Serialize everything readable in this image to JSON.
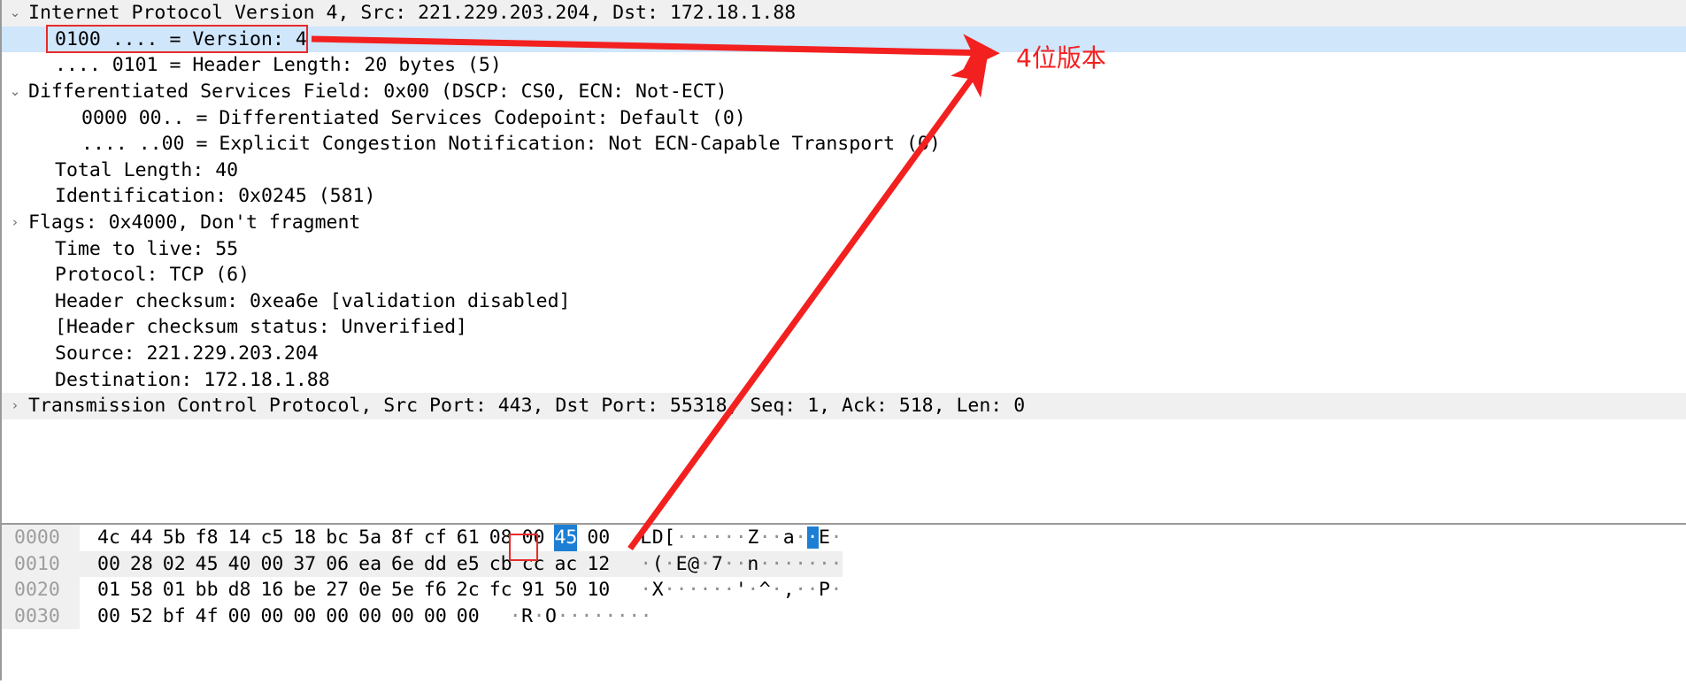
{
  "detail_tree": {
    "rows": [
      {
        "twisty": "expanded",
        "indent": 0,
        "text": "Internet Protocol Version 4, Src: 221.229.203.204, Dst: 172.18.1.88",
        "style": "proto"
      },
      {
        "twisty": "none",
        "indent": 1,
        "text": "0100 .... = Version: 4",
        "style": "selected"
      },
      {
        "twisty": "none",
        "indent": 1,
        "text": ".... 0101 = Header Length: 20 bytes (5)",
        "style": "normal"
      },
      {
        "twisty": "expanded",
        "indent": 0,
        "text": "Differentiated Services Field: 0x00 (DSCP: CS0, ECN: Not-ECT)",
        "style": "normal"
      },
      {
        "twisty": "none",
        "indent": 2,
        "text": "0000 00.. = Differentiated Services Codepoint: Default (0)",
        "style": "normal"
      },
      {
        "twisty": "none",
        "indent": 2,
        "text": ".... ..00 = Explicit Congestion Notification: Not ECN-Capable Transport (0)",
        "style": "normal"
      },
      {
        "twisty": "none",
        "indent": 1,
        "text": "Total Length: 40",
        "style": "normal"
      },
      {
        "twisty": "none",
        "indent": 1,
        "text": "Identification: 0x0245 (581)",
        "style": "normal"
      },
      {
        "twisty": "collapsed",
        "indent": 0,
        "text": "Flags: 0x4000, Don't fragment",
        "style": "normal"
      },
      {
        "twisty": "none",
        "indent": 1,
        "text": "Time to live: 55",
        "style": "normal"
      },
      {
        "twisty": "none",
        "indent": 1,
        "text": "Protocol: TCP (6)",
        "style": "normal"
      },
      {
        "twisty": "none",
        "indent": 1,
        "text": "Header checksum: 0xea6e [validation disabled]",
        "style": "normal"
      },
      {
        "twisty": "none",
        "indent": 1,
        "text": "[Header checksum status: Unverified]",
        "style": "normal"
      },
      {
        "twisty": "none",
        "indent": 1,
        "text": "Source: 221.229.203.204",
        "style": "normal"
      },
      {
        "twisty": "none",
        "indent": 1,
        "text": "Destination: 172.18.1.88",
        "style": "normal"
      },
      {
        "twisty": "collapsed",
        "indent": 0,
        "text": "Transmission Control Protocol, Src Port: 443, Dst Port: 55318, Seq: 1, Ack: 518, Len: 0",
        "style": "proto"
      }
    ]
  },
  "hex_dump": {
    "rows": [
      {
        "offset": "0000",
        "bytes_left": [
          "4c",
          "44",
          "5b",
          "f8",
          "14",
          "c5",
          "18",
          "bc"
        ],
        "bytes_right": [
          "5a",
          "8f",
          "cf",
          "61",
          "08",
          "00",
          "45",
          "00"
        ],
        "selected_byte_index": 14,
        "ascii": "LD[······Z··a··E·",
        "ascii_sel_index": 14,
        "shaded": false
      },
      {
        "offset": "0010",
        "bytes_left": [
          "00",
          "28",
          "02",
          "45",
          "40",
          "00",
          "37",
          "06"
        ],
        "bytes_right": [
          "ea",
          "6e",
          "dd",
          "e5",
          "cb",
          "cc",
          "ac",
          "12"
        ],
        "selected_byte_index": -1,
        "ascii": "·(·E@·7··n·······",
        "ascii_sel_index": -1,
        "shaded": true
      },
      {
        "offset": "0020",
        "bytes_left": [
          "01",
          "58",
          "01",
          "bb",
          "d8",
          "16",
          "be",
          "27"
        ],
        "bytes_right": [
          "0e",
          "5e",
          "f6",
          "2c",
          "fc",
          "91",
          "50",
          "10"
        ],
        "selected_byte_index": -1,
        "ascii": "·X······'·^·,··P·",
        "ascii_sel_index": -1,
        "shaded": false
      },
      {
        "offset": "0030",
        "bytes_left": [
          "00",
          "52",
          "bf",
          "4f",
          "00",
          "00",
          "00",
          "00"
        ],
        "bytes_right": [
          "00",
          "00",
          "00",
          "00"
        ],
        "selected_byte_index": -1,
        "ascii": "·R·O········",
        "ascii_sel_index": -1,
        "shaded": false
      }
    ]
  },
  "annotations": {
    "label_text": "4位版本",
    "arrow_color": "#f32020",
    "highlight_box_color": "#e82b2b"
  },
  "colors": {
    "selection_blue": "#cfe6fb",
    "byte_selection_blue": "#1d7fd4",
    "protocol_row_gray": "#f0f0f0",
    "annotation_red": "#f32020"
  },
  "icons": {
    "expanded": "⌄",
    "collapsed": "›"
  }
}
